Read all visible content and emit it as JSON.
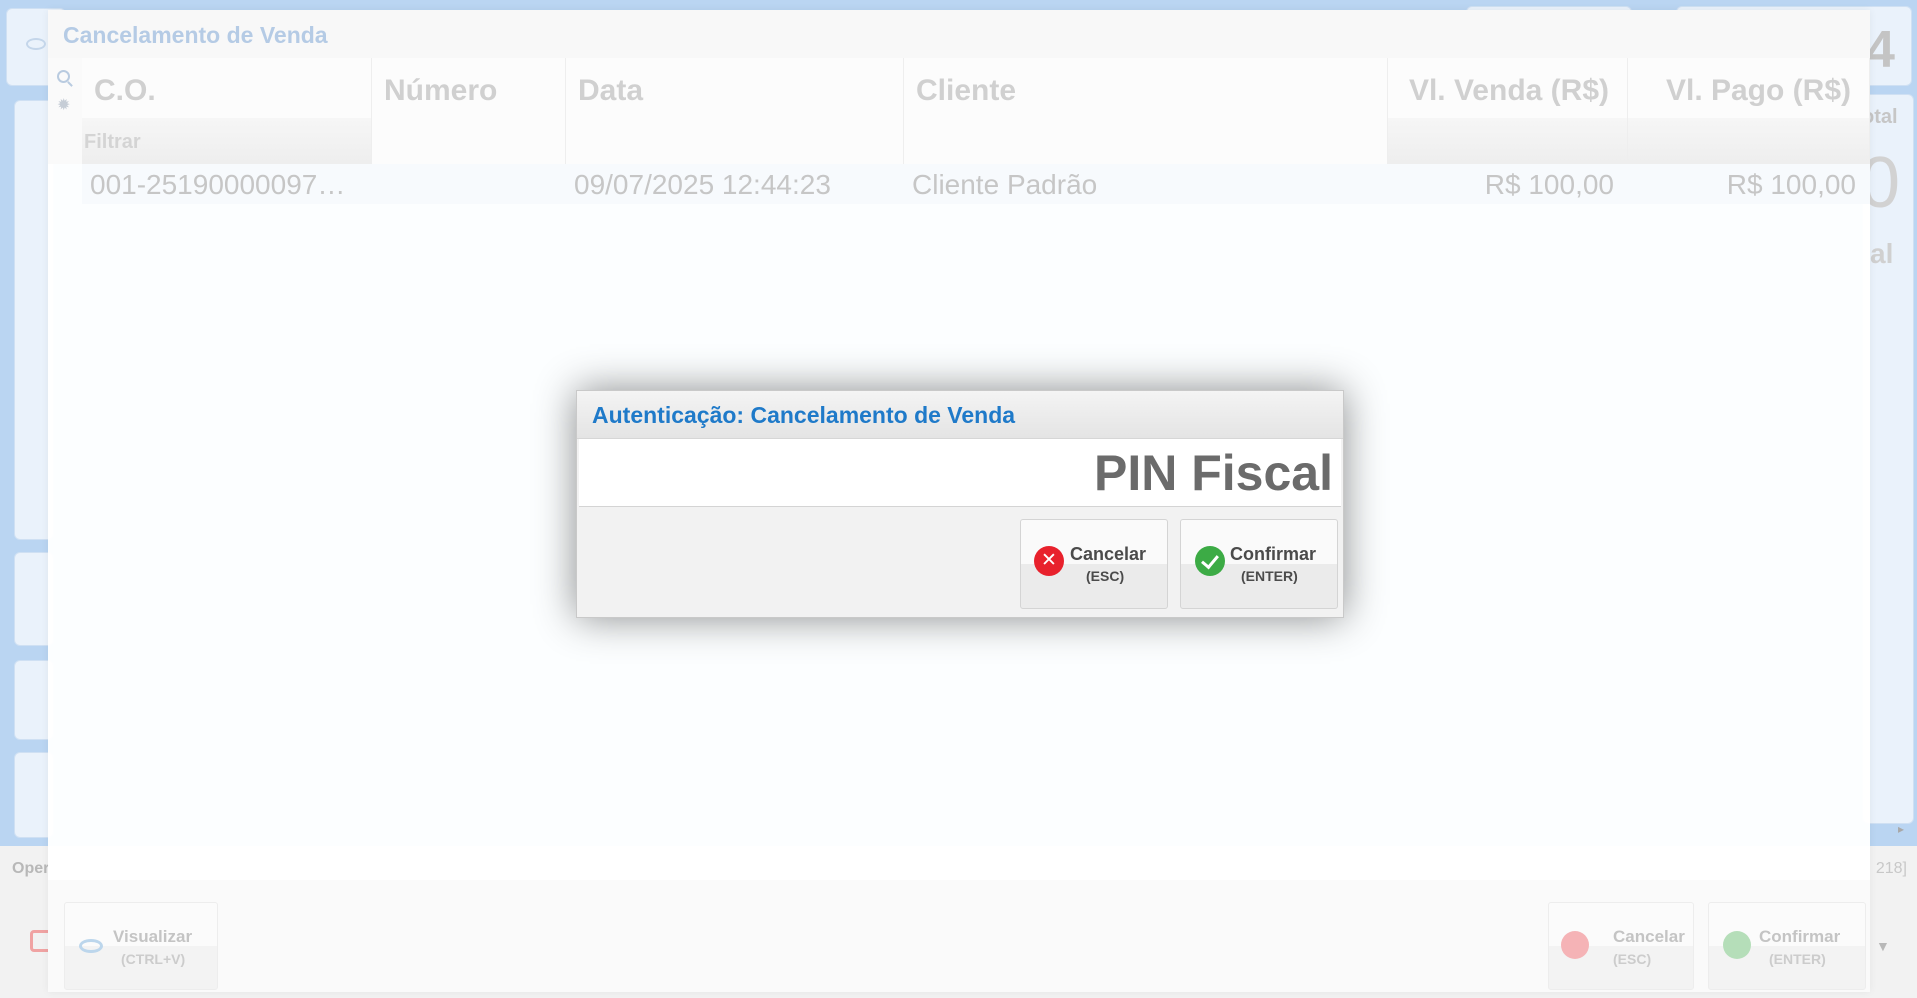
{
  "background": {
    "oper_fragment": "Oper",
    "code_fragment": "218]",
    "digit_fragment": "4",
    "total_fragment": "otal",
    "zero_fragment": "0",
    "al_fragment": "al"
  },
  "window": {
    "title": "Cancelamento de Venda",
    "filter_placeholder": "Filtrar",
    "columns": [
      "C.O.",
      "Número",
      "Data",
      "Cliente",
      "Vl. Venda (R$)",
      "Vl. Pago (R$)"
    ],
    "rows": [
      {
        "co": "001-25190000097…",
        "numero": "",
        "data": "09/07/2025 12:44:23",
        "cliente": "Cliente Padrão",
        "vl_venda": "R$ 100,00",
        "vl_pago": "R$ 100,00"
      }
    ],
    "footer": {
      "visualizar_label": "Visualizar",
      "visualizar_key": "(CTRL+V)",
      "cancelar_label": "Cancelar",
      "cancelar_key": "(ESC)",
      "confirmar_label": "Confirmar",
      "confirmar_key": "(ENTER)"
    }
  },
  "modal": {
    "title": "Autenticação: Cancelamento de Venda",
    "pin_placeholder": "PIN Fiscal",
    "cancel_label": "Cancelar",
    "cancel_key": "(ESC)",
    "confirm_label": "Confirmar",
    "confirm_key": "(ENTER)"
  },
  "colors": {
    "accent_blue": "#1f7ac9",
    "cancel_red": "#e8212c",
    "confirm_green": "#3cab45",
    "background_blue": "#bad5f2"
  }
}
